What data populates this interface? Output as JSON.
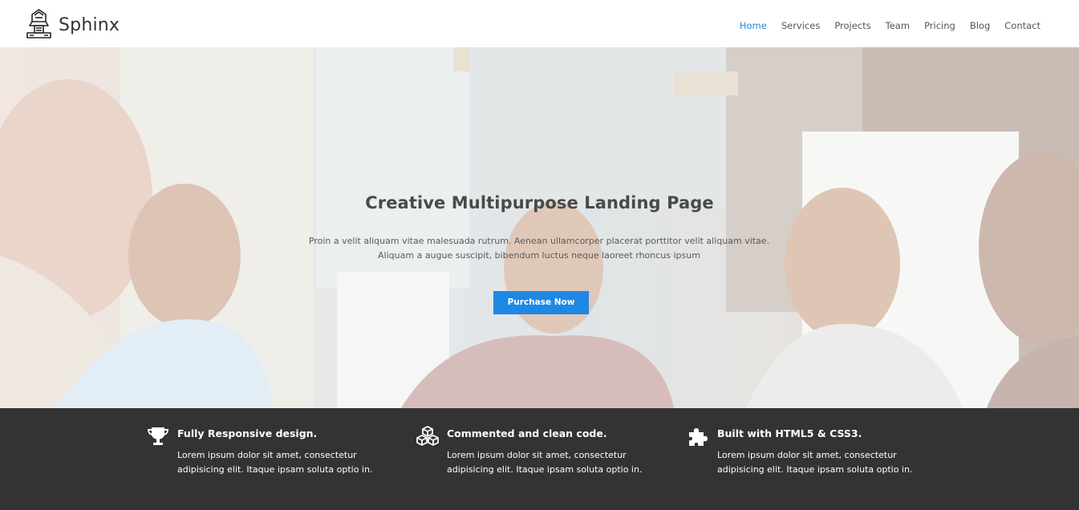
{
  "brand": {
    "name": "Sphinx",
    "logo_icon": "sphinx-logo-icon"
  },
  "nav": {
    "items": [
      {
        "label": "Home",
        "active": true
      },
      {
        "label": "Services",
        "active": false
      },
      {
        "label": "Projects",
        "active": false
      },
      {
        "label": "Team",
        "active": false
      },
      {
        "label": "Pricing",
        "active": false
      },
      {
        "label": "Blog",
        "active": false
      },
      {
        "label": "Contact",
        "active": false
      }
    ]
  },
  "hero": {
    "title": "Creative Multipurpose Landing Page",
    "subtitle_line1": "Proin a velit aliquam vitae malesuada rutrum. Aenean ullamcorper placerat porttitor velit aliquam vitae.",
    "subtitle_line2": "Aliquam a augue suscipit, bibendum luctus neque laoreet rhoncus ipsum",
    "cta_label": "Purchase Now"
  },
  "features": [
    {
      "icon": "trophy-icon",
      "title": "Fully Responsive design.",
      "text": "Lorem ipsum dolor sit amet, consectetur adipisicing elit. Itaque ipsam soluta optio in."
    },
    {
      "icon": "cubes-icon",
      "title": "Commented and clean code.",
      "text": "Lorem ipsum dolor sit amet, consectetur adipisicing elit. Itaque ipsam soluta optio in."
    },
    {
      "icon": "puzzle-icon",
      "title": "Built with HTML5 & CSS3.",
      "text": "Lorem ipsum dolor sit amet, consectetur adipisicing elit. Itaque ipsam soluta optio in."
    }
  ],
  "colors": {
    "accent": "#1e88e5",
    "dark_band": "#333333",
    "text": "#4a4a4a"
  }
}
